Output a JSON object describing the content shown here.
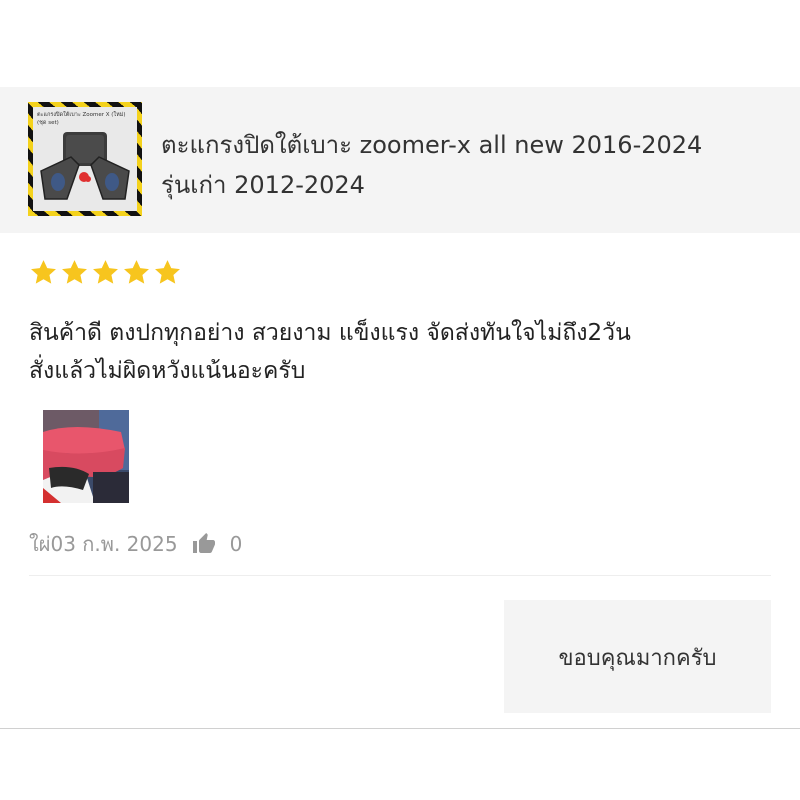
{
  "product": {
    "thumb_caption": "ตะแกรงปิดใต้เบาะ Zoomer X (ใหม่)",
    "thumb_sub": "(ชุด set)",
    "title_line1": "ตะแกรงปิดใต้เบาะ zoomer-x  all new 2016-2024",
    "title_line2": "รุ่นเก่า 2012-2024"
  },
  "review": {
    "rating": 5,
    "max_rating": 5,
    "star_color": "#f7c51e",
    "text_line1": "สินค้าดี ตงปกทุกอย่าง สวยงาม แข็งแรง จัดส่งทันใจไม่ถึง2วัน",
    "text_line2": "สั่งแล้วไม่ผิดหวังแน้นอะครับ",
    "date": "ใผ่03 ก.พ. 2025",
    "likes": "0"
  },
  "seller_reply": {
    "text": "ขอบคุณมากครับ"
  }
}
